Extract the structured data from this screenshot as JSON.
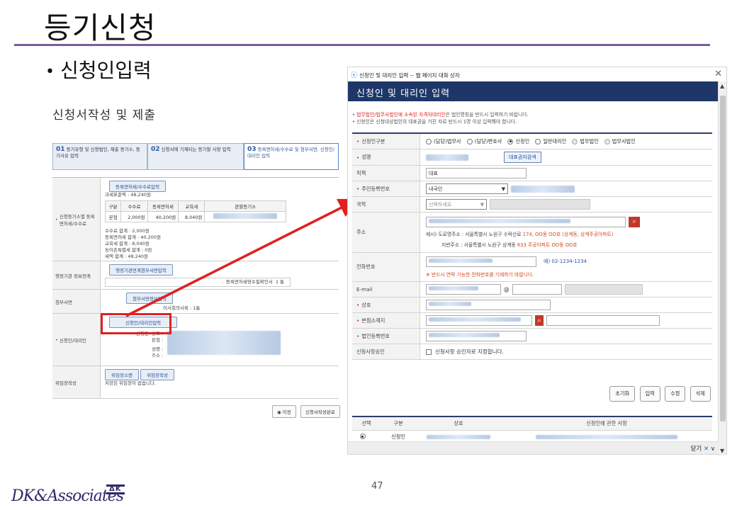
{
  "slide": {
    "title": "등기신청",
    "bullet": "신청인입력",
    "page_number": "47"
  },
  "logo": {
    "script_text": "DK&Associates",
    "mark_text": "ΔK"
  },
  "left_form": {
    "heading": "신청서작성 및 제출",
    "steps": [
      {
        "num": "01",
        "label": "등기유형 및 신청법인, 제출 등기소, 등기사유 입력"
      },
      {
        "num": "02",
        "label": "신청서에 기재되는 등기할 사항 입력"
      },
      {
        "num": "03",
        "label": "등록면허세/수수료 및 첨부서면, 신청인/대리인 입력"
      }
    ],
    "rows": {
      "fee": {
        "label": "신청등기소별 등록면허세/수수료",
        "button": "등록면허세/수수료입력",
        "tax_base": "과세표준액 : 48,240원",
        "table_headers": [
          "구분",
          "수수료",
          "등록면허세",
          "교육세",
          "관할등기소"
        ],
        "table_row": [
          "본점",
          "2,000원",
          "40,200원",
          "8,040원",
          ""
        ],
        "summary": [
          "수수료 합계 : 2,000원",
          "등록면허세 합계 : 40,200원",
          "교육세 합계 : 8,040원",
          "농어촌특별세 합계 : 0원",
          "세액 합계 : 48,240원"
        ]
      },
      "gov": {
        "label": "행정기관 정보연계",
        "button": "행정기관연계첨부서면입력",
        "cell_label": "등록면허세영수필확인서",
        "cell_value": "1 통"
      },
      "attach": {
        "label": "첨부서면",
        "button": "첨부서면정보입력",
        "cell_label": "이사회의사록",
        "cell_value": "1통"
      },
      "applicant": {
        "label": "신청인/대리인",
        "button": "신청인/대리인입력",
        "applicant_label": "신청인",
        "sub_labels": [
          "상호 :",
          "본점 :",
          "성명 :",
          "주소 :"
        ]
      },
      "delegation": {
        "label": "위임장작성",
        "buttons": [
          "위임장스캔",
          "위임장작성"
        ],
        "text": "저장된 위임장이 없습니다."
      }
    },
    "buttons": {
      "prev": "이전",
      "complete": "신청서작성완료"
    }
  },
  "dialog": {
    "window_title": "신청인 및 대리인 입력 -- 웹 페이지 대화 상자",
    "header": "신청인 및 대리인 입력",
    "notice_line1_red": "법무법인/법무사법인에 소속된 자격자대리인",
    "notice_line1_rest": "은 법인명칭을 반드시 입력하기 바랍니다.",
    "notice_line2": "신청인은 신청대상법인의 대표권을 가진 자로 반드시 1명 이상 입력해야 합니다.",
    "fields": {
      "type": {
        "label": "신청인구분",
        "options": [
          {
            "label": "(담당)법무사",
            "state": "off"
          },
          {
            "label": "(담당)변호사",
            "state": "off"
          },
          {
            "label": "신청인",
            "state": "on"
          },
          {
            "label": "일반대리인",
            "state": "off"
          },
          {
            "label": "법무법인",
            "state": "disabled"
          },
          {
            "label": "법무사법인",
            "state": "disabled"
          }
        ]
      },
      "name": {
        "label": "성명",
        "button": "대표권자검색"
      },
      "position": {
        "label": "직책",
        "value": "대표"
      },
      "id_number": {
        "label": "주민등록번호",
        "select_value": "내국인"
      },
      "nationality": {
        "label": "국적",
        "placeholder": "선택하세요"
      },
      "address": {
        "label": "주소",
        "example_prefix": "예시) 도로명주소 : 서울특별시 노원구 수락산로 ",
        "example_highlight": "174, OO동 OO호 (상계동, 상계주공아파트)",
        "jibun_prefix": "지번주소 : 서울특별시 노원구 상계동 ",
        "jibun_highlight": "633 주공아파트 OO동 OO호"
      },
      "phone": {
        "label": "전화번호",
        "example": "예) 02-1234-1234",
        "warning": "※ 반드시 연락 가능한 전화번호를 기재하기 바랍니다."
      },
      "email": {
        "label": "E-mail"
      },
      "company": {
        "label": "상호"
      },
      "head_office": {
        "label": "본점소재지"
      },
      "corp_number": {
        "label": "법인등록번호"
      },
      "approval": {
        "label": "신청사항승인",
        "checkbox_text": "신청사항 승인자로 지정합니다."
      }
    },
    "actions": [
      "초기화",
      "입력",
      "수정",
      "삭제"
    ],
    "list_headers": [
      "선택",
      "구분",
      "상호",
      "신청인에 관한 사항"
    ],
    "list_row": {
      "type": "신청인"
    },
    "footer_close": "닫기"
  },
  "colors": {
    "title_rule": "#7b5c9b",
    "dialog_header": "#1e3768",
    "highlight_red": "#e02020",
    "link_blue": "#1f4d8e"
  }
}
